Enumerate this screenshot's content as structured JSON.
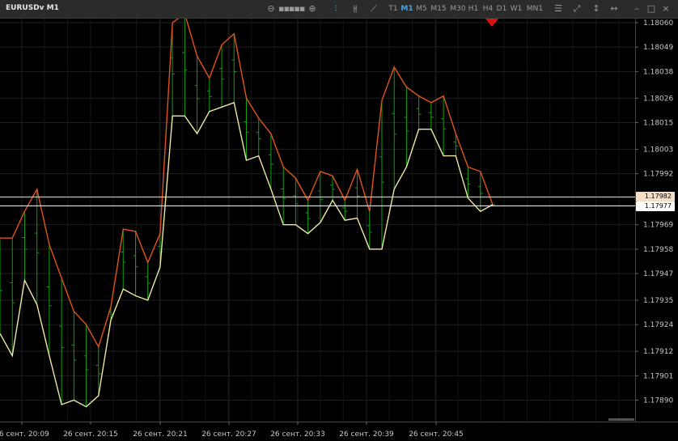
{
  "window": {
    "title": "EURUSDv M1"
  },
  "toolbar": {
    "zoom_out_icon": "minus-circle-icon",
    "zoom_in_icon": "plus-circle-icon",
    "timeframes": [
      "T1",
      "M1",
      "M5",
      "M15",
      "M30",
      "H1",
      "H4",
      "D1",
      "W1",
      "MN1"
    ],
    "active_timeframe": "M1",
    "window_buttons": [
      "–",
      "□",
      "×"
    ]
  },
  "chart_data": {
    "type": "candlestick",
    "symbol": "EURUSDv",
    "timeframe": "M1",
    "y_ticks": [
      "1.18060",
      "1.18049",
      "1.18038",
      "1.18026",
      "1.18015",
      "1.18003",
      "1.17992",
      "1.17981",
      "1.17969",
      "1.17958",
      "1.17947",
      "1.17935",
      "1.17924",
      "1.17912",
      "1.17901",
      "1.17890"
    ],
    "x_ticks": [
      "26 сент. 20:09",
      "26 сент. 20:15",
      "26 сент. 20:21",
      "26 сент. 20:27",
      "26 сент. 20:33",
      "26 сент. 20:39",
      "26 сент. 20:45"
    ],
    "bid_price": "1.17982",
    "ask_price": "1.17977",
    "high_envelope": [
      1.17963,
      1.17963,
      1.17975,
      1.17985,
      1.1796,
      1.17945,
      1.1793,
      1.17924,
      1.17914,
      1.17932,
      1.17967,
      1.17966,
      1.17952,
      1.17965,
      1.1806,
      1.18064,
      1.18045,
      1.18035,
      1.1805,
      1.18055,
      1.18026,
      1.18017,
      1.1801,
      1.17995,
      1.1799,
      1.1798,
      1.17993,
      1.17991,
      1.1798,
      1.17994,
      1.17975,
      1.18025,
      1.1804,
      1.18031,
      1.18027,
      1.18024,
      1.18027,
      1.1801,
      1.17995,
      1.17993,
      1.17978
    ],
    "low_envelope": [
      1.1792,
      1.1791,
      1.17944,
      1.17933,
      1.1791,
      1.17888,
      1.1789,
      1.17887,
      1.17892,
      1.17926,
      1.1794,
      1.17937,
      1.17935,
      1.1795,
      1.18018,
      1.18018,
      1.1801,
      1.1802,
      1.18022,
      1.18024,
      1.17998,
      1.18,
      1.17985,
      1.17969,
      1.17969,
      1.17965,
      1.1797,
      1.1798,
      1.17971,
      1.17972,
      1.17958,
      1.17958,
      1.17985,
      1.17995,
      1.18012,
      1.18012,
      1.18,
      1.18,
      1.17981,
      1.17975,
      1.17978
    ],
    "high_label": "",
    "low_label": ""
  }
}
